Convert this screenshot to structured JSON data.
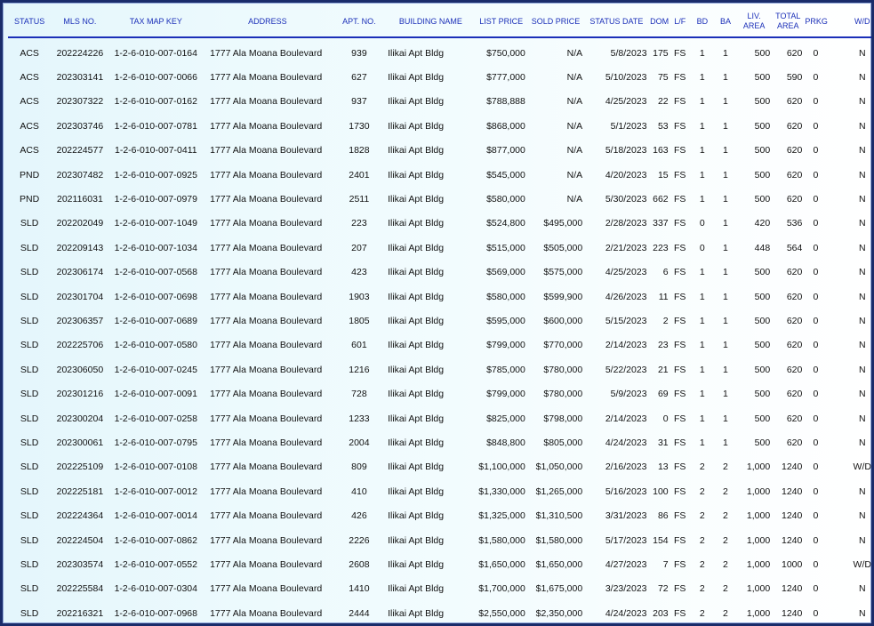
{
  "columns": [
    "STATUS",
    "MLS NO.",
    "TAX MAP KEY",
    "ADDRESS",
    "APT. NO.",
    "BUILDING NAME",
    "LIST PRICE",
    "SOLD PRICE",
    "STATUS DATE",
    "DOM",
    "L/F",
    "BD",
    "BA",
    "LIV. AREA",
    "TOTAL AREA",
    "PRKG",
    "W/D"
  ],
  "rows": [
    [
      "ACS",
      "202224226",
      "1-2-6-010-007-0164",
      "1777 Ala Moana Boulevard",
      "939",
      "Ilikai Apt Bldg",
      "$750,000",
      "N/A",
      "5/8/2023",
      "175",
      "FS",
      "1",
      "1",
      "500",
      "620",
      "0",
      "N"
    ],
    [
      "ACS",
      "202303141",
      "1-2-6-010-007-0066",
      "1777 Ala Moana Boulevard",
      "627",
      "Ilikai Apt Bldg",
      "$777,000",
      "N/A",
      "5/10/2023",
      "75",
      "FS",
      "1",
      "1",
      "500",
      "590",
      "0",
      "N"
    ],
    [
      "ACS",
      "202307322",
      "1-2-6-010-007-0162",
      "1777 Ala Moana Boulevard",
      "937",
      "Ilikai Apt Bldg",
      "$788,888",
      "N/A",
      "4/25/2023",
      "22",
      "FS",
      "1",
      "1",
      "500",
      "620",
      "0",
      "N"
    ],
    [
      "ACS",
      "202303746",
      "1-2-6-010-007-0781",
      "1777 Ala Moana Boulevard",
      "1730",
      "Ilikai Apt Bldg",
      "$868,000",
      "N/A",
      "5/1/2023",
      "53",
      "FS",
      "1",
      "1",
      "500",
      "620",
      "0",
      "N"
    ],
    [
      "ACS",
      "202224577",
      "1-2-6-010-007-0411",
      "1777 Ala Moana Boulevard",
      "1828",
      "Ilikai Apt Bldg",
      "$877,000",
      "N/A",
      "5/18/2023",
      "163",
      "FS",
      "1",
      "1",
      "500",
      "620",
      "0",
      "N"
    ],
    [
      "PND",
      "202307482",
      "1-2-6-010-007-0925",
      "1777 Ala Moana Boulevard",
      "2401",
      "Ilikai Apt Bldg",
      "$545,000",
      "N/A",
      "4/20/2023",
      "15",
      "FS",
      "1",
      "1",
      "500",
      "620",
      "0",
      "N"
    ],
    [
      "PND",
      "202116031",
      "1-2-6-010-007-0979",
      "1777 Ala Moana Boulevard",
      "2511",
      "Ilikai Apt Bldg",
      "$580,000",
      "N/A",
      "5/30/2023",
      "662",
      "FS",
      "1",
      "1",
      "500",
      "620",
      "0",
      "N"
    ],
    [
      "SLD",
      "202202049",
      "1-2-6-010-007-1049",
      "1777 Ala Moana Boulevard",
      "223",
      "Ilikai Apt Bldg",
      "$524,800",
      "$495,000",
      "2/28/2023",
      "337",
      "FS",
      "0",
      "1",
      "420",
      "536",
      "0",
      "N"
    ],
    [
      "SLD",
      "202209143",
      "1-2-6-010-007-1034",
      "1777 Ala Moana Boulevard",
      "207",
      "Ilikai Apt Bldg",
      "$515,000",
      "$505,000",
      "2/21/2023",
      "223",
      "FS",
      "0",
      "1",
      "448",
      "564",
      "0",
      "N"
    ],
    [
      "SLD",
      "202306174",
      "1-2-6-010-007-0568",
      "1777 Ala Moana Boulevard",
      "423",
      "Ilikai Apt Bldg",
      "$569,000",
      "$575,000",
      "4/25/2023",
      "6",
      "FS",
      "1",
      "1",
      "500",
      "620",
      "0",
      "N"
    ],
    [
      "SLD",
      "202301704",
      "1-2-6-010-007-0698",
      "1777 Ala Moana Boulevard",
      "1903",
      "Ilikai Apt Bldg",
      "$580,000",
      "$599,900",
      "4/26/2023",
      "11",
      "FS",
      "1",
      "1",
      "500",
      "620",
      "0",
      "N"
    ],
    [
      "SLD",
      "202306357",
      "1-2-6-010-007-0689",
      "1777 Ala Moana Boulevard",
      "1805",
      "Ilikai Apt Bldg",
      "$595,000",
      "$600,000",
      "5/15/2023",
      "2",
      "FS",
      "1",
      "1",
      "500",
      "620",
      "0",
      "N"
    ],
    [
      "SLD",
      "202225706",
      "1-2-6-010-007-0580",
      "1777 Ala Moana Boulevard",
      "601",
      "Ilikai Apt Bldg",
      "$799,000",
      "$770,000",
      "2/14/2023",
      "23",
      "FS",
      "1",
      "1",
      "500",
      "620",
      "0",
      "N"
    ],
    [
      "SLD",
      "202306050",
      "1-2-6-010-007-0245",
      "1777 Ala Moana Boulevard",
      "1216",
      "Ilikai Apt Bldg",
      "$785,000",
      "$780,000",
      "5/22/2023",
      "21",
      "FS",
      "1",
      "1",
      "500",
      "620",
      "0",
      "N"
    ],
    [
      "SLD",
      "202301216",
      "1-2-6-010-007-0091",
      "1777 Ala Moana Boulevard",
      "728",
      "Ilikai Apt Bldg",
      "$799,000",
      "$780,000",
      "5/9/2023",
      "69",
      "FS",
      "1",
      "1",
      "500",
      "620",
      "0",
      "N"
    ],
    [
      "SLD",
      "202300204",
      "1-2-6-010-007-0258",
      "1777 Ala Moana Boulevard",
      "1233",
      "Ilikai Apt Bldg",
      "$825,000",
      "$798,000",
      "2/14/2023",
      "0",
      "FS",
      "1",
      "1",
      "500",
      "620",
      "0",
      "N"
    ],
    [
      "SLD",
      "202300061",
      "1-2-6-010-007-0795",
      "1777 Ala Moana Boulevard",
      "2004",
      "Ilikai Apt Bldg",
      "$848,800",
      "$805,000",
      "4/24/2023",
      "31",
      "FS",
      "1",
      "1",
      "500",
      "620",
      "0",
      "N"
    ],
    [
      "SLD",
      "202225109",
      "1-2-6-010-007-0108",
      "1777 Ala Moana Boulevard",
      "809",
      "Ilikai Apt Bldg",
      "$1,100,000",
      "$1,050,000",
      "2/16/2023",
      "13",
      "FS",
      "2",
      "2",
      "1,000",
      "1240",
      "0",
      "W/D"
    ],
    [
      "SLD",
      "202225181",
      "1-2-6-010-007-0012",
      "1777 Ala Moana Boulevard",
      "410",
      "Ilikai Apt Bldg",
      "$1,330,000",
      "$1,265,000",
      "5/16/2023",
      "100",
      "FS",
      "2",
      "2",
      "1,000",
      "1240",
      "0",
      "N"
    ],
    [
      "SLD",
      "202224364",
      "1-2-6-010-007-0014",
      "1777 Ala Moana Boulevard",
      "426",
      "Ilikai Apt Bldg",
      "$1,325,000",
      "$1,310,500",
      "3/31/2023",
      "86",
      "FS",
      "2",
      "2",
      "1,000",
      "1240",
      "0",
      "N"
    ],
    [
      "SLD",
      "202224504",
      "1-2-6-010-007-0862",
      "1777 Ala Moana Boulevard",
      "2226",
      "Ilikai Apt Bldg",
      "$1,580,000",
      "$1,580,000",
      "5/17/2023",
      "154",
      "FS",
      "2",
      "2",
      "1,000",
      "1240",
      "0",
      "N"
    ],
    [
      "SLD",
      "202303574",
      "1-2-6-010-007-0552",
      "1777 Ala Moana Boulevard",
      "2608",
      "Ilikai Apt Bldg",
      "$1,650,000",
      "$1,650,000",
      "4/27/2023",
      "7",
      "FS",
      "2",
      "2",
      "1,000",
      "1000",
      "0",
      "W/D"
    ],
    [
      "SLD",
      "202225584",
      "1-2-6-010-007-0304",
      "1777 Ala Moana Boulevard",
      "1410",
      "Ilikai Apt Bldg",
      "$1,700,000",
      "$1,675,000",
      "3/23/2023",
      "72",
      "FS",
      "2",
      "2",
      "1,000",
      "1240",
      "0",
      "N"
    ],
    [
      "SLD",
      "202216321",
      "1-2-6-010-007-0968",
      "1777 Ala Moana Boulevard",
      "2444",
      "Ilikai Apt Bldg",
      "$2,550,000",
      "$2,350,000",
      "4/24/2023",
      "203",
      "FS",
      "2",
      "2",
      "1,000",
      "1240",
      "0",
      "N"
    ]
  ]
}
